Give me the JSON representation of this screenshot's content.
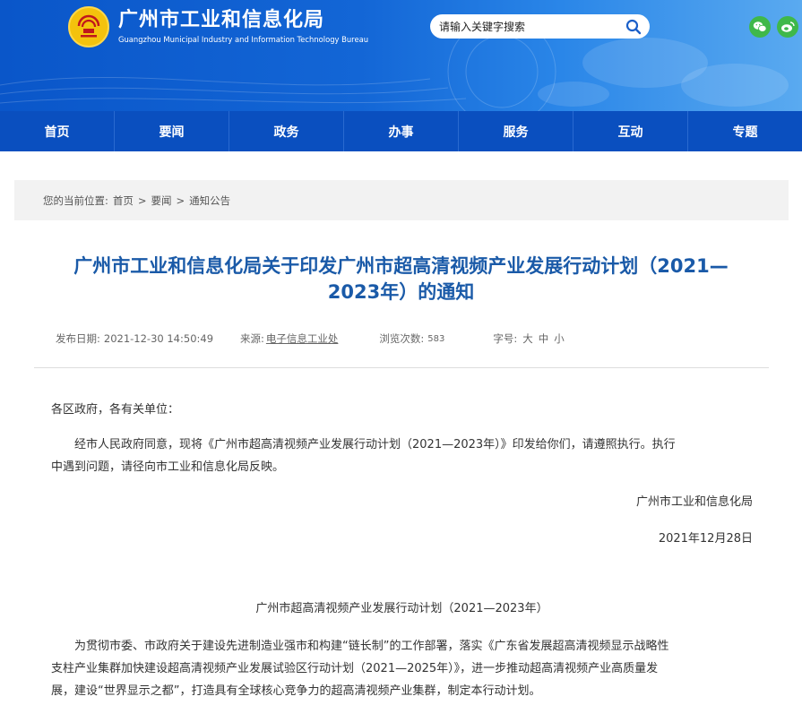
{
  "header": {
    "title_cn": "广州市工业和信息化局",
    "title_en": "Guangzhou Municipal Industry and Information Technology Bureau",
    "search_placeholder": "请输入关键字搜索"
  },
  "nav": {
    "items": [
      "首页",
      "要闻",
      "政务",
      "办事",
      "服务",
      "互动",
      "专题"
    ]
  },
  "breadcrumb": {
    "prefix": "您的当前位置:",
    "items": [
      "首页",
      "要闻",
      "通知公告"
    ],
    "sep": ">"
  },
  "article": {
    "title_line1": "广州市工业和信息化局关于印发广州市超高清视频产业发展行动计划（2021—",
    "title_line2": "2023年）的通知",
    "meta": {
      "date_label": "发布日期:",
      "date_value": "2021-12-30 14:50:49",
      "source_label": "来源:",
      "source_value": "电子信息工业处",
      "views_label": "浏览次数:",
      "views_value": "583",
      "fontsize_label": "字号:",
      "fontsize_options": [
        "大",
        "中",
        "小"
      ]
    },
    "salutation": "各区政府，各有关单位：",
    "para1_line1": "经市人民政府同意，现将《广州市超高清视频产业发展行动计划（2021—2023年）》印发给你们，请遵照执行。执行",
    "para1_line2": "中遇到问题，请径向市工业和信息化局反映。",
    "signature": "广州市工业和信息化局",
    "sign_date": "2021年12月28日",
    "plan_title": "广州市超高清视频产业发展行动计划（2021—2023年）",
    "para2_line1": "为贯彻市委、市政府关于建设先进制造业强市和构建“链长制”的工作部署，落实《广东省发展超高清视频显示战略性",
    "para2_line2": "支柱产业集群加快建设超高清视频产业发展试验区行动计划（2021—2025年）》，进一步推动超高清视频产业高质量发",
    "para2_line3": "展，建设“世界显示之都”，打造具有全球核心竞争力的超高清视频产业集群，制定本行动计划。"
  },
  "colors": {
    "header_blue": "#0a56c9",
    "nav_blue": "#0a4fbf",
    "title_blue": "#1a5aa8",
    "logo_gold": "#f4c20d",
    "social_green": "#3fb84a"
  },
  "icons": [
    "emblem-logo-icon",
    "search-icon",
    "wechat-icon",
    "weibo-icon"
  ]
}
